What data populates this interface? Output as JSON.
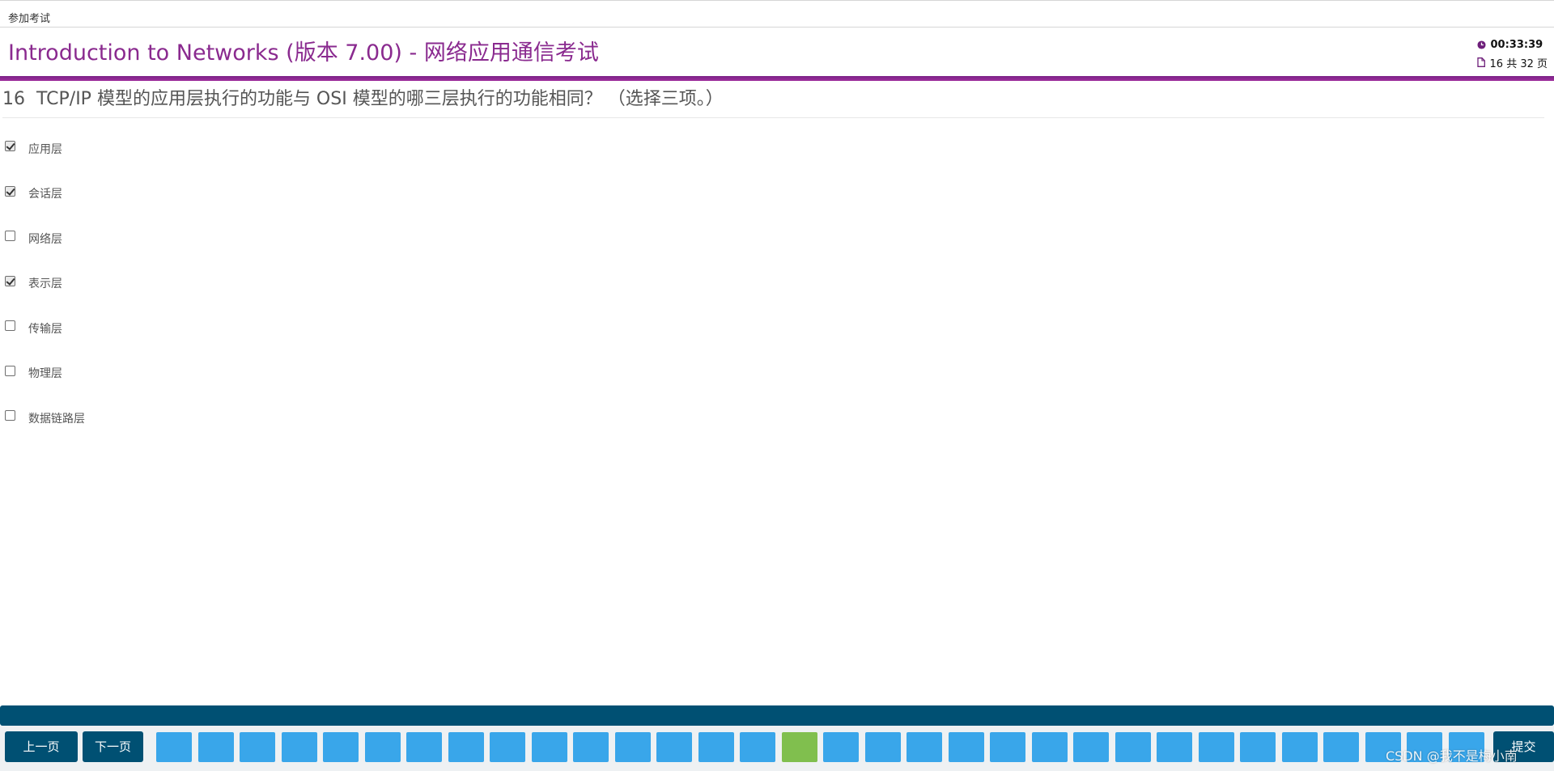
{
  "topbar": {
    "breadcrumb": "参加考试"
  },
  "header": {
    "title": "Introduction to Networks (版本 7.00) - 网络应用通信考试",
    "timer": "00:33:39",
    "page_info": "16 共 32 页"
  },
  "question": {
    "number": "16",
    "text": "TCP/IP 模型的应用层执行的功能与 OSI 模型的哪三层执行的功能相同？ （选择三项。）"
  },
  "options": [
    {
      "label": "应用层",
      "checked": true
    },
    {
      "label": "会话层",
      "checked": true
    },
    {
      "label": "网络层",
      "checked": false
    },
    {
      "label": "表示层",
      "checked": true
    },
    {
      "label": "传输层",
      "checked": false
    },
    {
      "label": "物理层",
      "checked": false
    },
    {
      "label": "数据链路层",
      "checked": false
    }
  ],
  "footer": {
    "prev_label": "上一页",
    "next_label": "下一页",
    "submit_label": "提交",
    "total_pages": 32,
    "current_page": 16
  },
  "colors": {
    "title_purple": "#8a2a8f",
    "nav_dark_blue": "#005073",
    "page_blue": "#39a6ea",
    "page_current_green": "#80bf4e"
  },
  "watermark": "CSDN @我不是梅小南"
}
